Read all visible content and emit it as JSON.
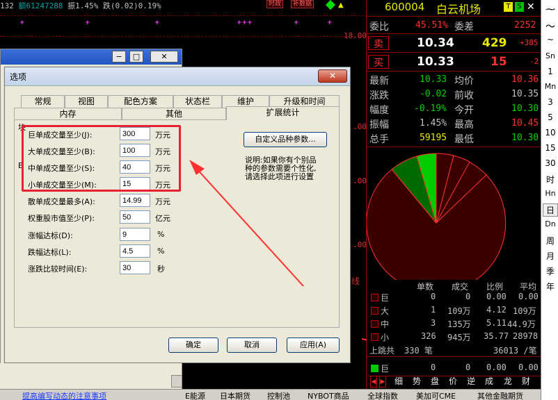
{
  "chart_top": {
    "left_num": "132",
    "amount": "额61247288",
    "amplitude": "振1.45%",
    "change": "跌(0.02)0.19%",
    "btn1": "时政",
    "btn2": "补数据"
  },
  "axis_labels": [
    "18.00",
    ".00",
    ".00",
    ".00"
  ],
  "axis_side_label": "线",
  "bg_window": {
    "min": "−",
    "max": "□",
    "close": "✕",
    "bottom_text": "提高编写动态的注意事项"
  },
  "dialog": {
    "title": "选项",
    "close_label": "✕",
    "tabs_row1": [
      "常规",
      "视图",
      "配色方案",
      "状态栏",
      "维护",
      "升级和时间"
    ],
    "tabs_row2": [
      "内存",
      "其他",
      "扩展统计"
    ],
    "fields": [
      {
        "label": "巨单成交量至少(J):",
        "value": "300",
        "unit": "万元"
      },
      {
        "label": "大单成交量至少(B):",
        "value": "100",
        "unit": "万元"
      },
      {
        "label": "中单成交量至少(S):",
        "value": "40",
        "unit": "万元"
      },
      {
        "label": "小单成交量至少(M):",
        "value": "15",
        "unit": "万元"
      },
      {
        "label": "散单成交量最多(A):",
        "value": "14.99",
        "unit": "万元"
      },
      {
        "label": "权重股市值至少(P):",
        "value": "50",
        "unit": "亿元"
      },
      {
        "label": "涨幅达标(D):",
        "value": "9",
        "unit": "%"
      },
      {
        "label": "跌幅达标(L):",
        "value": "4.5",
        "unit": "%"
      },
      {
        "label": "涨跌比较时间(E):",
        "value": "30",
        "unit": "秒"
      }
    ],
    "side_left_chars": [
      "块",
      "B"
    ],
    "custom_button": "自定义品种参数...",
    "description": [
      "说明:如果你有个别品",
      "种的参数需要个性化,",
      "请选择此项进行设置"
    ],
    "ok": "确定",
    "cancel": "取消",
    "apply": "应用(A)"
  },
  "quote": {
    "code": "600004",
    "name": "白云机场",
    "badge_t": "T",
    "badge_s": "S",
    "weibi_label": "委比",
    "weibi_value": "45.51%",
    "weicha_label": "委差",
    "weicha_value": "2252",
    "sell_label": "卖",
    "sell_price": "10.34",
    "sell_vol": "429",
    "sell_chg": "+385",
    "buy_label": "买",
    "buy_price": "10.33",
    "buy_vol": "15",
    "buy_chg": "-2",
    "stats": [
      {
        "l1": "最新",
        "v1": "10.33",
        "l2": "均价",
        "v2": "10.36"
      },
      {
        "l1": "涨跌",
        "v1": "-0.02",
        "l2": "前收",
        "v2": "10.35"
      },
      {
        "l1": "幅度",
        "v1": "-0.19%",
        "l2": "今开",
        "v2": "10.30"
      },
      {
        "l1": "振幅",
        "v1": "1.45%",
        "l2": "最高",
        "v2": "10.45"
      },
      {
        "l1": "总手",
        "v1": "59195",
        "l2": "最低",
        "v2": "10.30"
      }
    ],
    "table_headers": [
      "单数",
      "成交",
      "比例",
      "平均"
    ],
    "table_rows": [
      {
        "name": "巨",
        "count": "0",
        "amount": "0",
        "ratio": "0.00",
        "avg": "0.00"
      },
      {
        "name": "大",
        "count": "1",
        "amount": "109万",
        "ratio": "4.12",
        "avg": "109万"
      },
      {
        "name": "中",
        "count": "3",
        "amount": "135万",
        "ratio": "5.11",
        "avg": "44.9万"
      },
      {
        "name": "小",
        "count": "326",
        "amount": "945万",
        "ratio": "35.77",
        "avg": "28978"
      }
    ],
    "up_label": "上跳共",
    "up_count": "330 笔",
    "up_value": "36013 /笔",
    "bottom_row": {
      "name": "巨",
      "count": "0",
      "amount": "0",
      "ratio": "0.00",
      "avg": "0.00"
    },
    "func_tabs": [
      "细",
      "势",
      "盘",
      "价",
      "逆",
      "成",
      "龙",
      "财"
    ]
  },
  "pie": {
    "colors": {
      "green": "#006a00",
      "bright_green": "#00cc00",
      "red": "#3a0000",
      "outline": "#ff3030"
    }
  },
  "far_right_labels": [
    "Sn",
    "1",
    "Mn",
    "3",
    "5",
    "10",
    "15",
    "30",
    "时",
    "Hn",
    "日",
    "Dn",
    "周",
    "月",
    "季",
    "年"
  ],
  "bottom_tabs": [
    "E能源",
    "日本期货",
    "控制池",
    "NYBOT商品",
    "全球指数",
    "美加可CME",
    "其他金融期货"
  ]
}
